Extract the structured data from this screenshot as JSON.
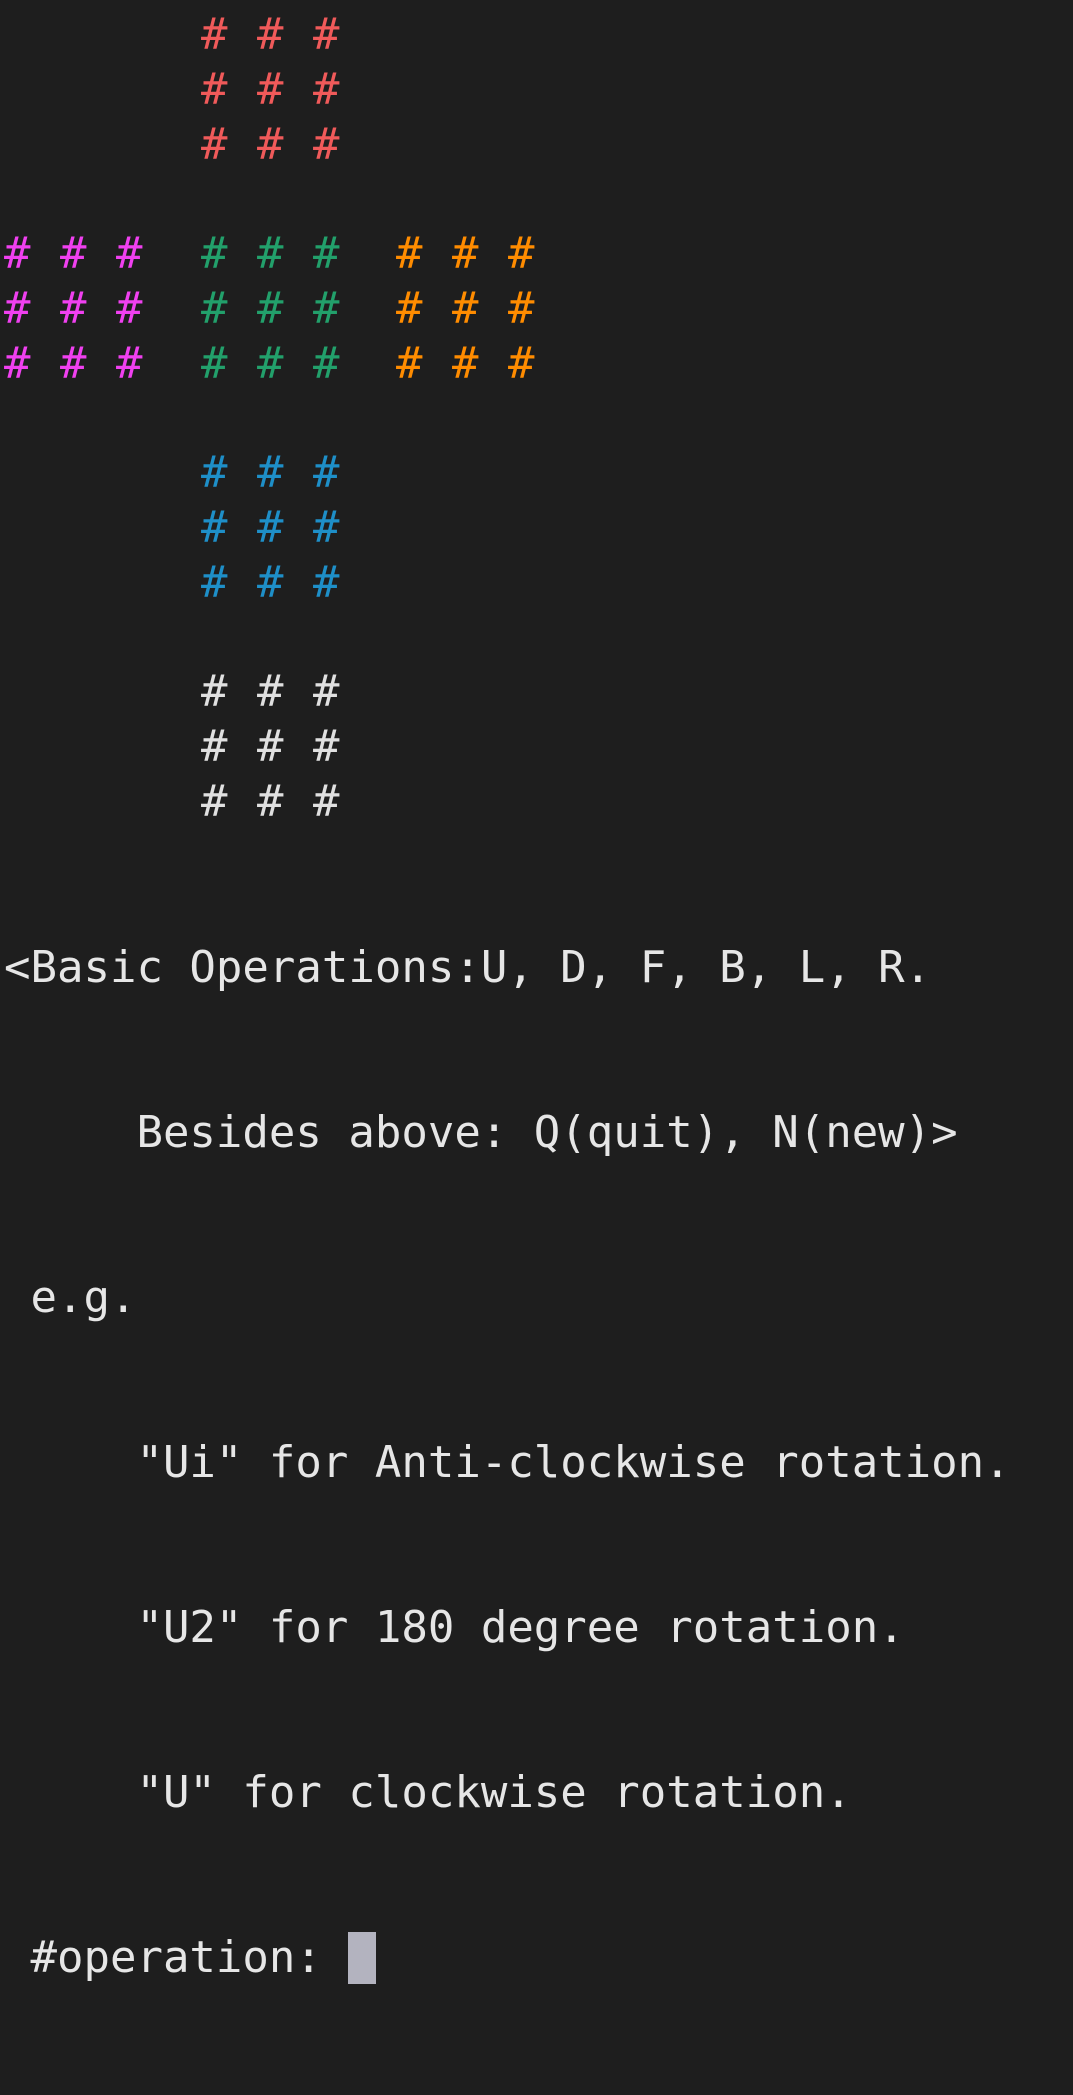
{
  "colors": {
    "background": "#1e1e1e",
    "text": "#e6e6e6",
    "cursor": "#b3b3bf",
    "red": "#f05a5a",
    "magenta": "#f040f0",
    "green": "#22a06b",
    "orange": "#ff8c00",
    "blue": "#1e8fc8",
    "white": "#e0e0e0"
  },
  "cube": {
    "top": [
      [
        "red",
        "red",
        "red"
      ],
      [
        "red",
        "red",
        "red"
      ],
      [
        "red",
        "red",
        "red"
      ]
    ],
    "left": [
      [
        "magenta",
        "magenta",
        "magenta"
      ],
      [
        "magenta",
        "magenta",
        "magenta"
      ],
      [
        "magenta",
        "magenta",
        "magenta"
      ]
    ],
    "front": [
      [
        "green",
        "green",
        "green"
      ],
      [
        "green",
        "green",
        "green"
      ],
      [
        "green",
        "green",
        "green"
      ]
    ],
    "right": [
      [
        "orange",
        "orange",
        "orange"
      ],
      [
        "orange",
        "orange",
        "orange"
      ],
      [
        "orange",
        "orange",
        "orange"
      ]
    ],
    "bottom": [
      [
        "blue",
        "blue",
        "blue"
      ],
      [
        "blue",
        "blue",
        "blue"
      ],
      [
        "blue",
        "blue",
        "blue"
      ]
    ],
    "back": [
      [
        "white",
        "white",
        "white"
      ],
      [
        "white",
        "white",
        "white"
      ],
      [
        "white",
        "white",
        "white"
      ]
    ]
  },
  "cell_glyph": "#",
  "help": {
    "line1": "<Basic Operations:U, D, F, B, L, R.",
    "line2": "     Besides above: Q(quit), N(new)>",
    "line3": " e.g.",
    "line4": "     \"Ui\" for Anti-clockwise rotation.",
    "line5": "     \"U2\" for 180 degree rotation.",
    "line6": "     \"U\" for clockwise rotation.",
    "prompt": " #operation: "
  },
  "input": {
    "value": ""
  }
}
